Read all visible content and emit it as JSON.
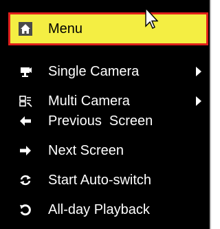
{
  "menu": {
    "items": [
      {
        "label": "Menu",
        "icon": "home-icon",
        "selected": true,
        "has_submenu": false
      },
      {
        "label": "Single Camera",
        "icon": "camera-icon",
        "selected": false,
        "has_submenu": true
      },
      {
        "label": "Multi Camera",
        "icon": "multi-camera-icon",
        "selected": false,
        "has_submenu": true
      },
      {
        "label": "Previous  Screen",
        "icon": "arrow-left-icon",
        "selected": false,
        "has_submenu": false
      },
      {
        "label": "Next Screen",
        "icon": "arrow-right-icon",
        "selected": false,
        "has_submenu": false
      },
      {
        "label": "Start Auto-switch",
        "icon": "auto-switch-icon",
        "selected": false,
        "has_submenu": false
      },
      {
        "label": "All-day Playback",
        "icon": "playback-icon",
        "selected": false,
        "has_submenu": false
      }
    ]
  },
  "colors": {
    "background": "#000000",
    "selected_fill": "#f4ee43",
    "selected_border": "#e0201b",
    "text": "#ffffff"
  }
}
